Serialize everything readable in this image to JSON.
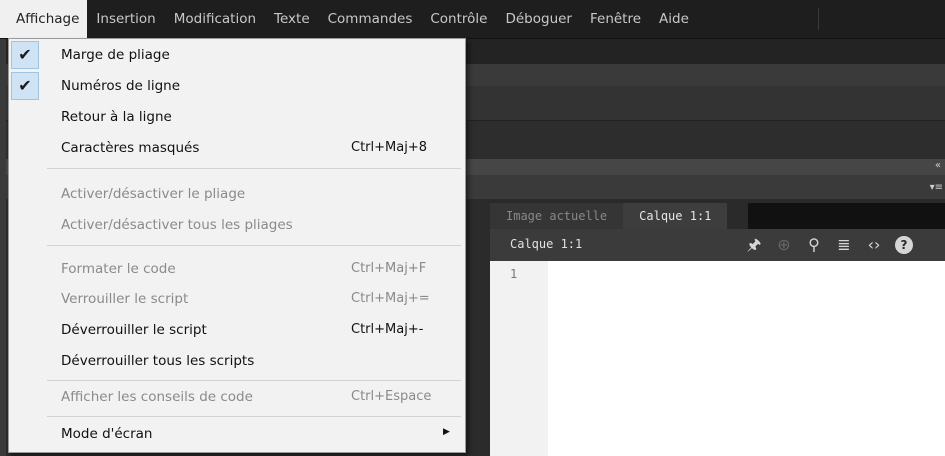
{
  "menubar": {
    "items": [
      {
        "label": "Affichage",
        "active": true
      },
      {
        "label": "Insertion"
      },
      {
        "label": "Modification"
      },
      {
        "label": "Texte"
      },
      {
        "label": "Commandes"
      },
      {
        "label": "Contrôle"
      },
      {
        "label": "Déboguer"
      },
      {
        "label": "Fenêtre"
      },
      {
        "label": "Aide"
      }
    ]
  },
  "menu": {
    "items": [
      {
        "label": "Marge de pliage",
        "checked": true,
        "enabled": true,
        "shortcut": ""
      },
      {
        "label": "Numéros de ligne",
        "checked": true,
        "enabled": true,
        "shortcut": ""
      },
      {
        "label": "Retour à la ligne",
        "checked": false,
        "enabled": true,
        "shortcut": ""
      },
      {
        "label": "Caractères masqués",
        "checked": false,
        "enabled": true,
        "shortcut": "Ctrl+Maj+8"
      },
      {
        "label": "Activer/désactiver le pliage",
        "checked": false,
        "enabled": false,
        "shortcut": ""
      },
      {
        "label": "Activer/désactiver tous les pliages",
        "checked": false,
        "enabled": false,
        "shortcut": ""
      },
      {
        "label": "Formater le code",
        "checked": false,
        "enabled": false,
        "shortcut": "Ctrl+Maj+F"
      },
      {
        "label": "Verrouiller le script",
        "checked": false,
        "enabled": false,
        "shortcut": "Ctrl+Maj+="
      },
      {
        "label": "Déverrouiller le script",
        "checked": false,
        "enabled": true,
        "shortcut": "Ctrl+Maj+-"
      },
      {
        "label": "Déverrouiller tous les scripts",
        "checked": false,
        "enabled": true,
        "shortcut": ""
      },
      {
        "label": "Afficher les conseils de code",
        "checked": false,
        "enabled": false,
        "shortcut": "Ctrl+Espace"
      },
      {
        "label": "Mode d'écran",
        "checked": false,
        "enabled": true,
        "shortcut": "",
        "submenu": true
      }
    ],
    "check_glyph": "✔",
    "submenu_glyph": "▶"
  },
  "panel": {
    "tabs": [
      "Image actuelle",
      "Calque 1:1"
    ],
    "active_tab": 1,
    "target_label": "Calque 1:1",
    "toolbar_icons": [
      "pin-icon",
      "crosshair-icon",
      "search-icon",
      "format-lines-icon",
      "code-brackets-icon",
      "help-icon"
    ],
    "line_numbers": [
      "1"
    ]
  },
  "side_controls": {
    "collapse": "«",
    "options": "▾≡"
  }
}
